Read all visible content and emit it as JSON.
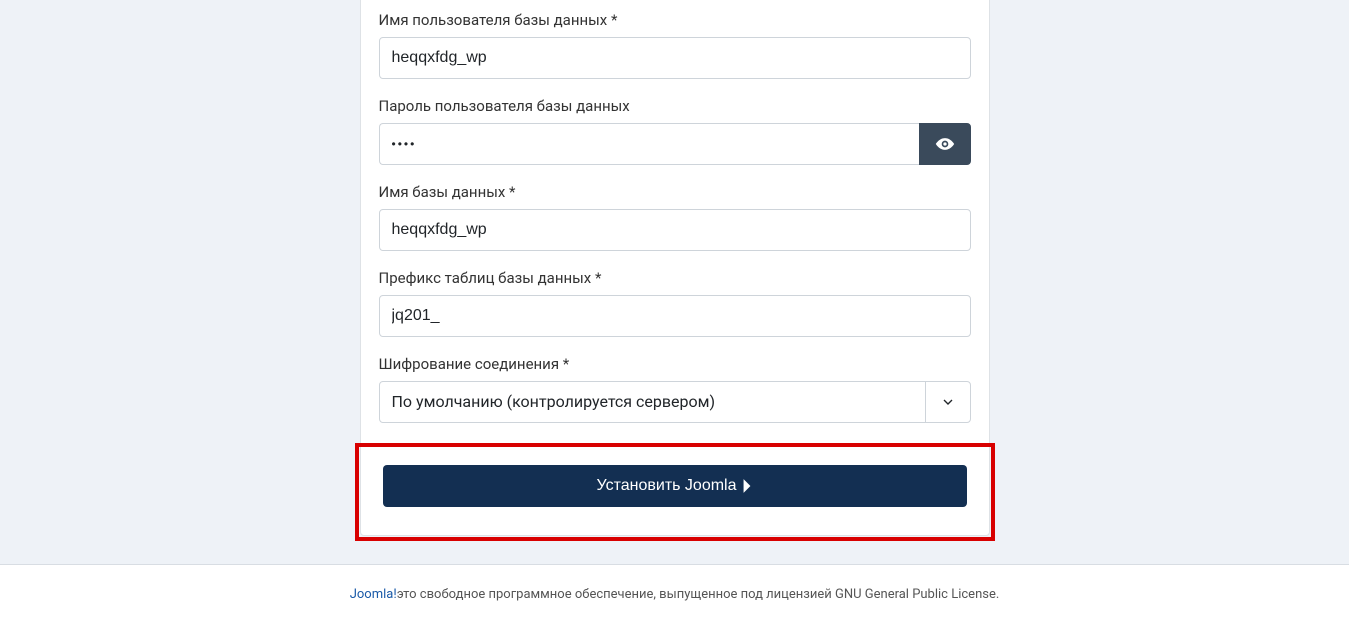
{
  "form": {
    "db_user": {
      "label": "Имя пользователя базы данных *",
      "value": "heqqxfdg_wp"
    },
    "db_password": {
      "label": "Пароль пользователя базы данных",
      "value": "••••"
    },
    "db_name": {
      "label": "Имя базы данных *",
      "value": "heqqxfdg_wp"
    },
    "db_prefix": {
      "label": "Префикс таблиц базы данных *",
      "value": "jq201_"
    },
    "db_encryption": {
      "label": "Шифрование соединения *",
      "selected": "По умолчанию (контролируется сервером)"
    }
  },
  "actions": {
    "install_label": "Установить Joomla"
  },
  "footer": {
    "link_text": "Joomla!",
    "text": "это свободное программное обеспечение, выпущенное под лицензией GNU General Public License."
  }
}
